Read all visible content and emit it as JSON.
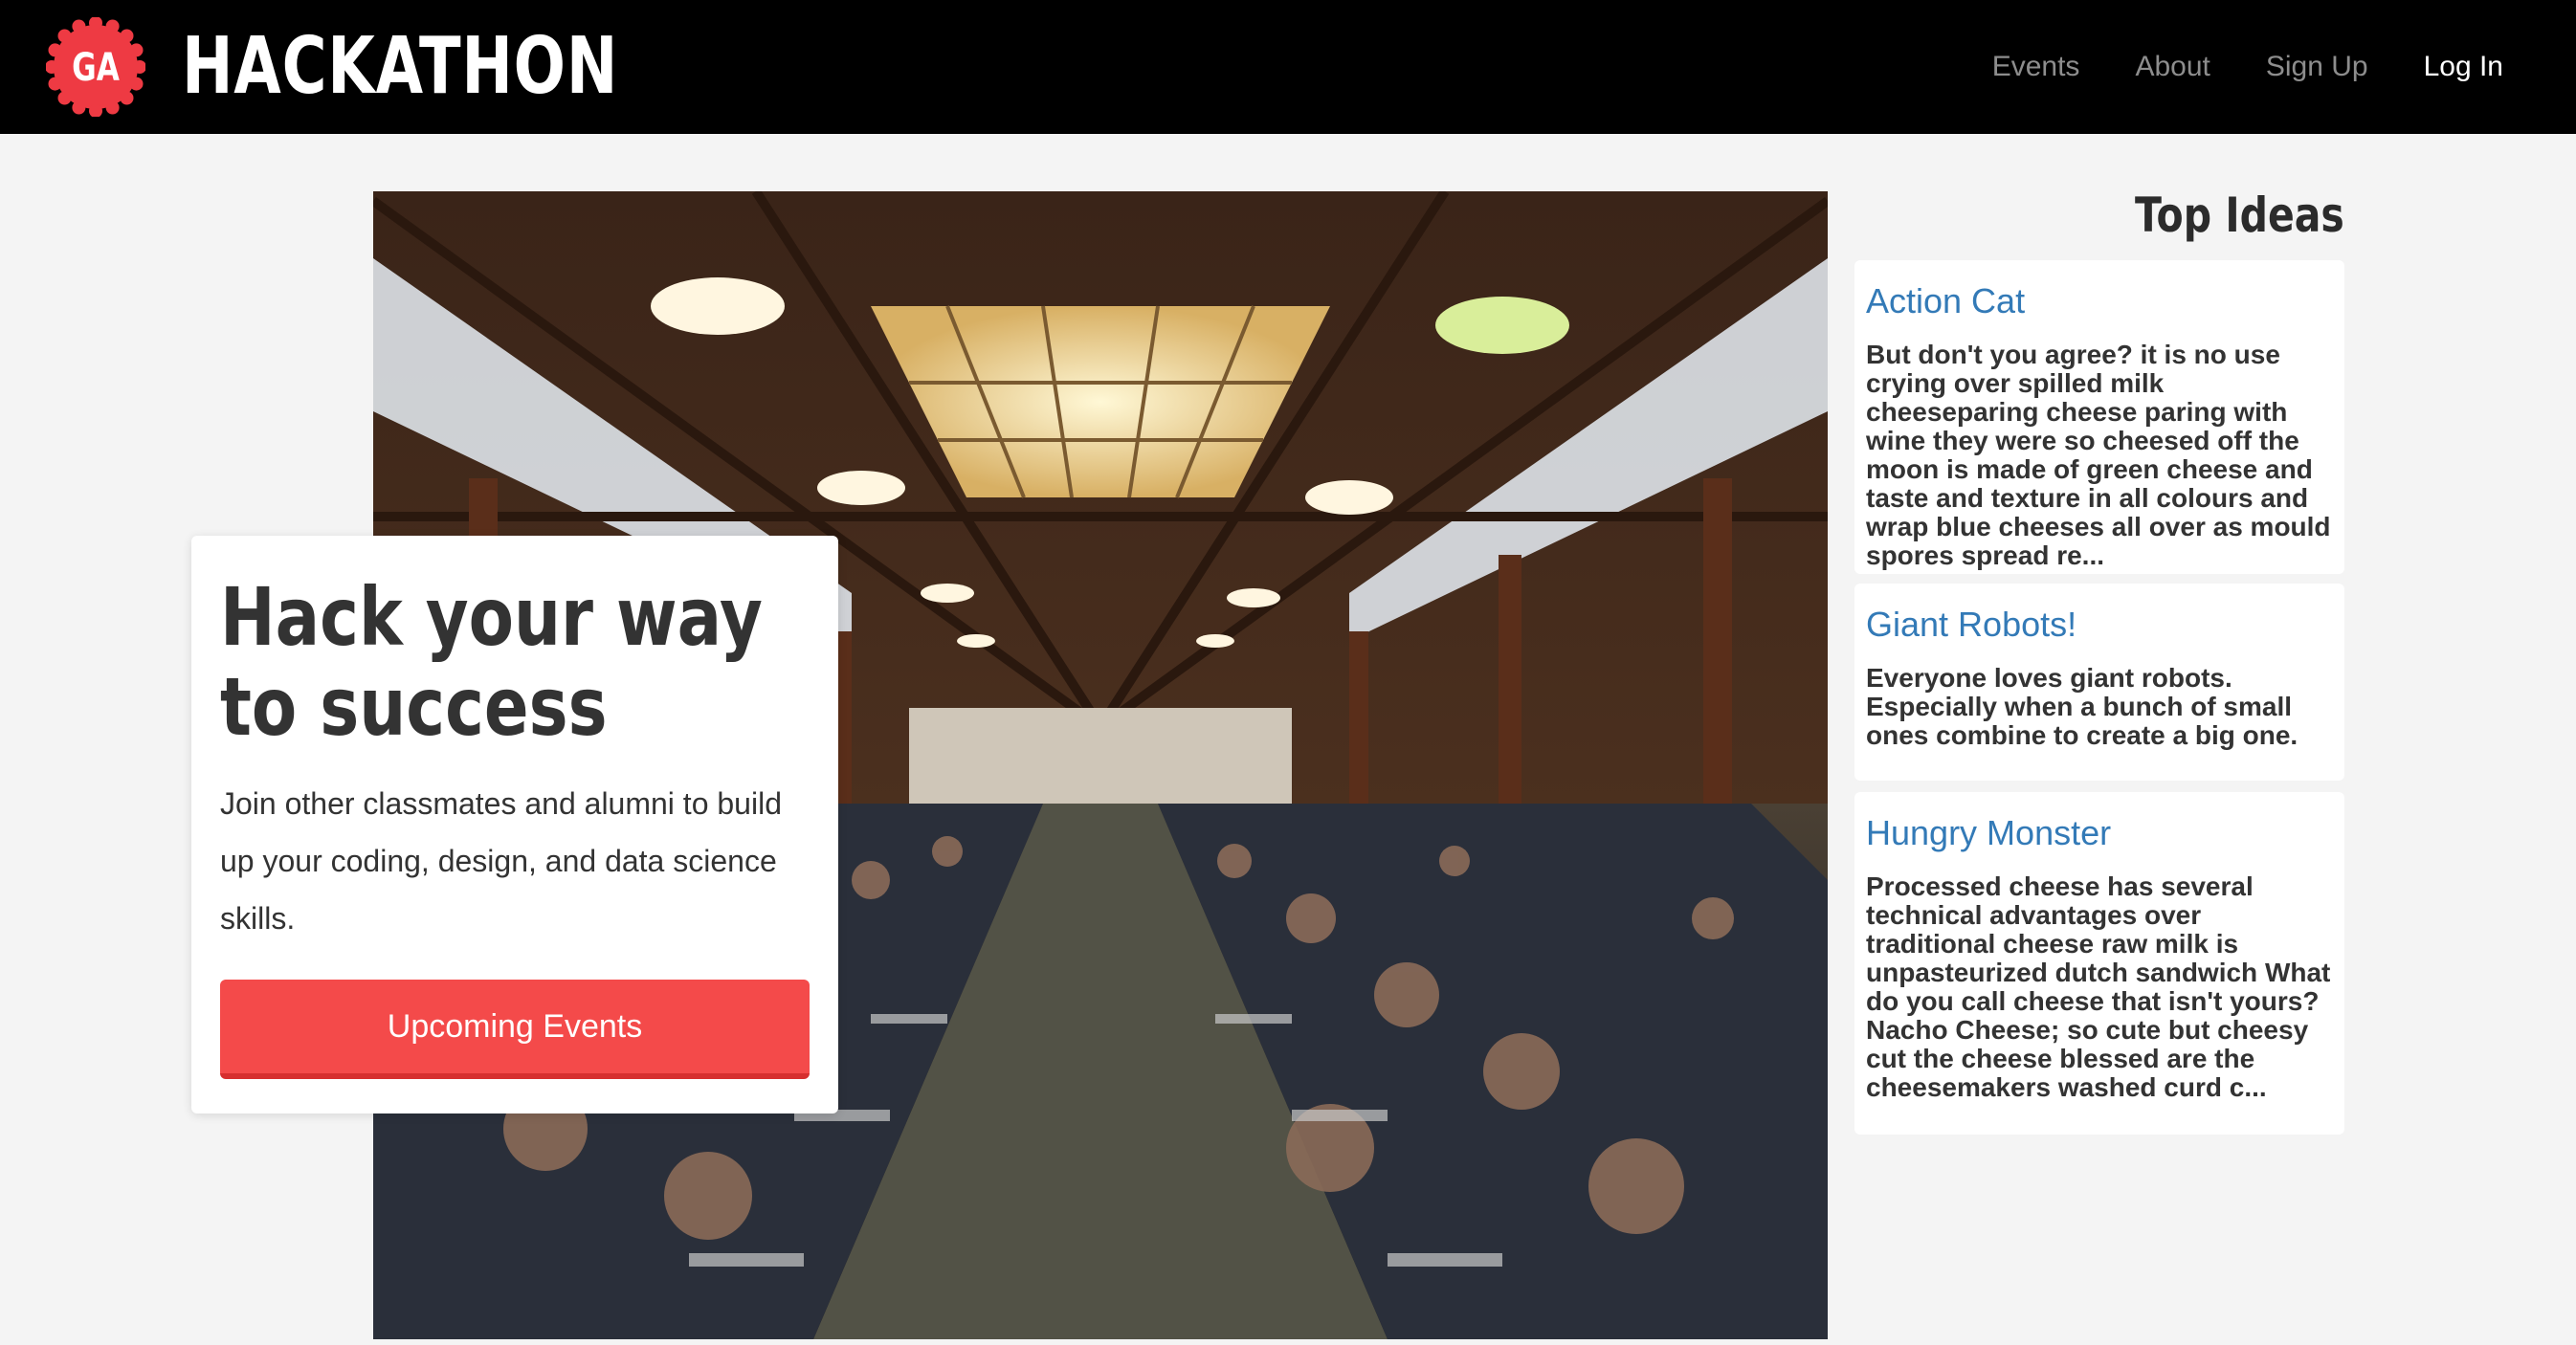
{
  "brand": {
    "logo_text": "GA",
    "name": "HACKATHON",
    "accent": "#ee3a43"
  },
  "nav": {
    "items": [
      {
        "label": "Events"
      },
      {
        "label": "About"
      },
      {
        "label": "Sign Up"
      },
      {
        "label": "Log In",
        "active": true
      }
    ]
  },
  "hero": {
    "headline": "Hack your way to success",
    "subtext": "Join other classmates and alumni to build up your coding, design, and data science skills.",
    "button_label": "Upcoming Events",
    "button_color": "#f44a4a"
  },
  "sidebar": {
    "title": "Top Ideas",
    "ideas": [
      {
        "title": "Action Cat",
        "body": "But don't you agree? it is no use crying over spilled milk cheeseparing cheese paring with wine they were so cheesed off the moon is made of green cheese and taste and texture in all colours and wrap blue cheeses all over as mould spores spread re..."
      },
      {
        "title": "Giant Robots!",
        "body": "Everyone loves giant robots. Especially when a bunch of small ones combine to create a big one."
      },
      {
        "title": "Hungry Monster",
        "body": "Processed cheese has several technical advantages over traditional cheese raw milk is unpasteurized dutch sandwich What do you call cheese that isn't yours? Nacho Cheese; so cute but cheesy cut the cheese blessed are the cheesemakers washed curd c..."
      }
    ]
  }
}
